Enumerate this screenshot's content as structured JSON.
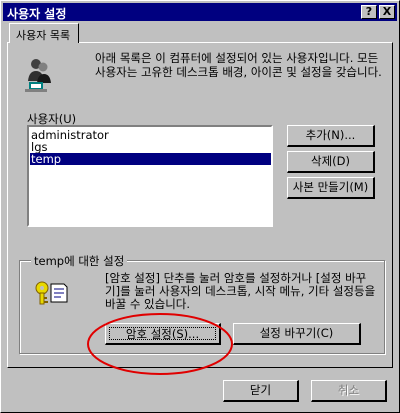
{
  "window": {
    "title": "사용자 설정",
    "help_label": "?",
    "close_label": "X"
  },
  "tab": {
    "label": "사용자 목록"
  },
  "intro": {
    "text": "아래 목록은 이 컴퓨터에 설정되어 있는 사용자입니다. 모든 사용자는 고유한 데스크톱 배경, 아이콘 및 설정을 갖습니다."
  },
  "users": {
    "label": "사용자(U)",
    "items": [
      "administrator",
      "lgs",
      "temp"
    ],
    "selected_index": 2
  },
  "buttons": {
    "add": "추가(N)...",
    "delete": "삭제(D)",
    "copy": "사본 만들기(M)"
  },
  "settings_group": {
    "title": "temp에 대한 설정",
    "description": "[암호 설정] 단추를 눌러 암호를 설정하거나 [설정 바꾸기]를 눌러 사용자의 데스크톱, 시작 메뉴, 기타 설정등을 바꿀 수 있습니다.",
    "password_button": "암호 설정(S)...",
    "change_settings_button": "설정 바꾸기(C)"
  },
  "footer": {
    "close": "닫기",
    "cancel": "취소"
  },
  "colors": {
    "titlebar": "#000080",
    "face": "#c0c0c0",
    "selection": "#000080",
    "annotation": "#e00000"
  },
  "icons": [
    "users-icon",
    "key-icon"
  ]
}
